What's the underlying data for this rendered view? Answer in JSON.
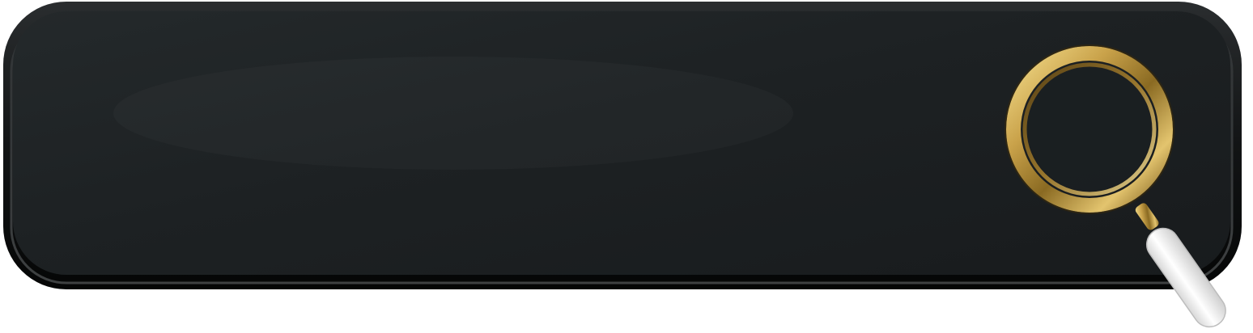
{
  "search": {
    "value": "",
    "placeholder": "",
    "icon": "magnifying-glass-icon"
  },
  "colors": {
    "bar_face": "#1f2325",
    "bar_frame": "#0d0f10",
    "lens_ring": "#c9a24a",
    "handle": "#f2f2f2"
  }
}
